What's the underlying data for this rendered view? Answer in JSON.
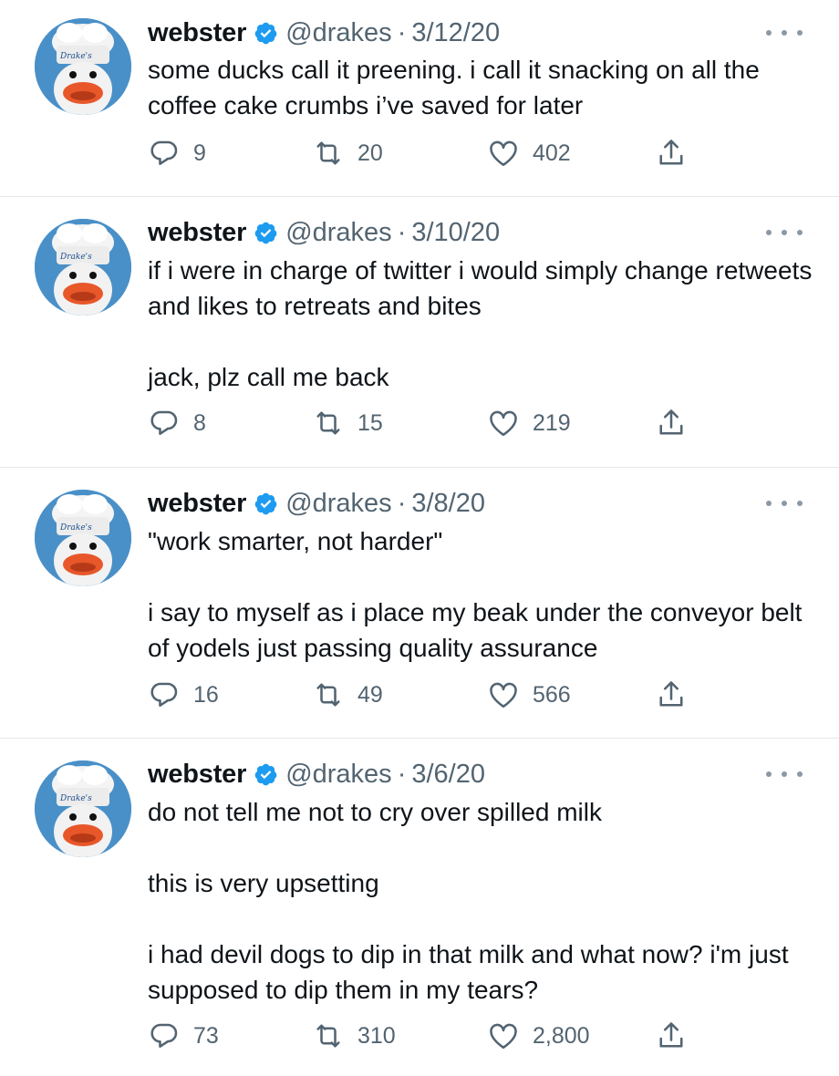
{
  "profile": {
    "name": "webster",
    "handle": "@drakes",
    "separator": "·",
    "avatar_brand_text": "Drake's"
  },
  "colors": {
    "verified_blue": "#1d9bf0",
    "muted": "#536471",
    "avatar_bg": "#4a90c8",
    "beak": "#e8572a"
  },
  "tweets": [
    {
      "date": "3/12/20",
      "lines": [
        "some ducks call it preening. i call it snacking on all the coffee cake crumbs i’ve saved for later"
      ],
      "replies": "9",
      "retweets": "20",
      "likes": "402"
    },
    {
      "date": "3/10/20",
      "lines": [
        "if i were in charge of twitter i would simply change retweets and likes to retreats and bites",
        "jack, plz call me back"
      ],
      "replies": "8",
      "retweets": "15",
      "likes": "219"
    },
    {
      "date": "3/8/20",
      "lines": [
        "\"work smarter, not harder\"",
        "i say to myself as i place my beak under the conveyor belt of yodels just passing quality assurance"
      ],
      "replies": "16",
      "retweets": "49",
      "likes": "566"
    },
    {
      "date": "3/6/20",
      "lines": [
        "do not tell me not to cry over spilled milk",
        "this is very upsetting",
        "i had devil dogs to dip in that milk and what now? i'm just supposed to dip them in my tears?"
      ],
      "replies": "73",
      "retweets": "310",
      "likes": "2,800"
    }
  ]
}
